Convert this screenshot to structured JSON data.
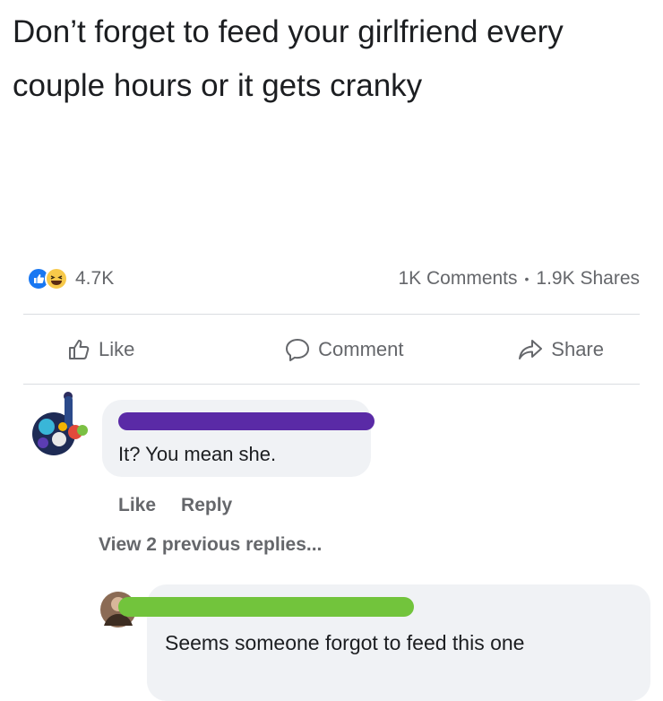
{
  "post": {
    "text": "Don’t forget to feed your girlfriend every couple hours or it gets cranky"
  },
  "stats": {
    "reaction_count": "4.7K",
    "comments": "1K Comments",
    "separator": "•",
    "shares": "1.9K Shares"
  },
  "actions": {
    "like": "Like",
    "comment": "Comment",
    "share": "Share"
  },
  "comments": [
    {
      "text": "It? You mean she.",
      "like_label": "Like",
      "reply_label": "Reply"
    }
  ],
  "view_replies": "View 2 previous replies...",
  "reply": {
    "text": "Seems someone forgot to feed this one"
  },
  "colors": {
    "censor_purple": "#5a2aa6",
    "censor_green": "#72c43c",
    "like_blue": "#1877f2",
    "haha_yellow": "#f7c94a"
  }
}
